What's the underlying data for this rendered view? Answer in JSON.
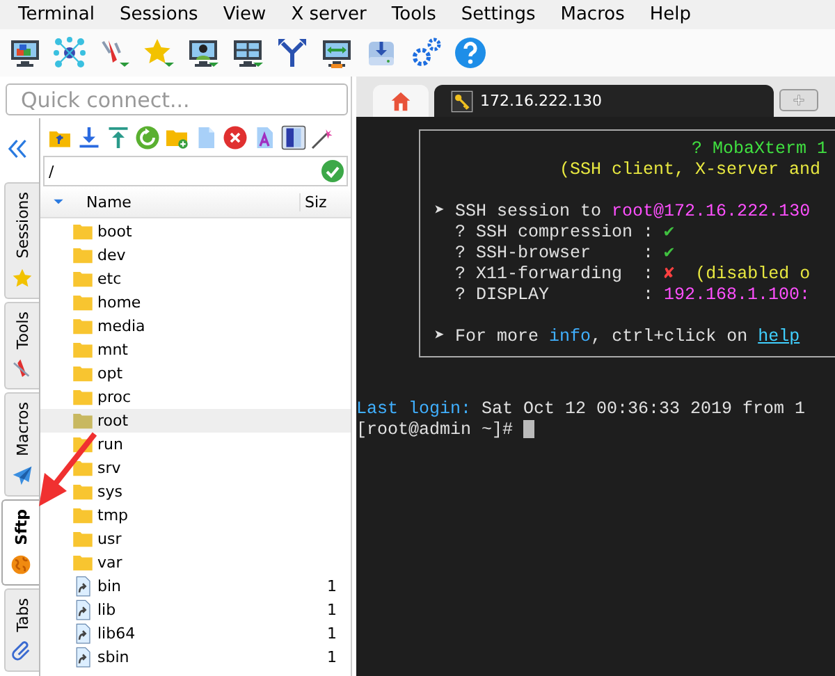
{
  "menu": [
    "Terminal",
    "Sessions",
    "View",
    "X server",
    "Tools",
    "Settings",
    "Macros",
    "Help"
  ],
  "quick_connect": {
    "placeholder": "Quick connect..."
  },
  "side_tabs": [
    {
      "label": "Sessions",
      "kind": "star",
      "selected": false
    },
    {
      "label": "Tools",
      "kind": "tools",
      "selected": false
    },
    {
      "label": "Macros",
      "kind": "plane",
      "selected": false
    },
    {
      "label": "Sftp",
      "kind": "globe",
      "selected": true
    },
    {
      "label": "Tabs",
      "kind": "clip",
      "selected": false
    }
  ],
  "sftp": {
    "path": "/",
    "columns": [
      "Name",
      "Siz"
    ],
    "rows": [
      {
        "kind": "folder",
        "name": "boot",
        "selected": false
      },
      {
        "kind": "folder",
        "name": "dev",
        "selected": false
      },
      {
        "kind": "folder",
        "name": "etc",
        "selected": false
      },
      {
        "kind": "folder",
        "name": "home",
        "selected": false
      },
      {
        "kind": "folder",
        "name": "media",
        "selected": false
      },
      {
        "kind": "folder",
        "name": "mnt",
        "selected": false
      },
      {
        "kind": "folder",
        "name": "opt",
        "selected": false
      },
      {
        "kind": "folder",
        "name": "proc",
        "selected": false
      },
      {
        "kind": "folder",
        "name": "root",
        "selected": true
      },
      {
        "kind": "folder",
        "name": "run",
        "selected": false
      },
      {
        "kind": "folder",
        "name": "srv",
        "selected": false
      },
      {
        "kind": "folder",
        "name": "sys",
        "selected": false
      },
      {
        "kind": "folder",
        "name": "tmp",
        "selected": false
      },
      {
        "kind": "folder",
        "name": "usr",
        "selected": false
      },
      {
        "kind": "folder",
        "name": "var",
        "selected": false
      },
      {
        "kind": "link",
        "name": "bin",
        "size": "1",
        "selected": false
      },
      {
        "kind": "link",
        "name": "lib",
        "size": "1",
        "selected": false
      },
      {
        "kind": "link",
        "name": "lib64",
        "size": "1",
        "selected": false
      },
      {
        "kind": "link",
        "name": "sbin",
        "size": "1",
        "selected": false
      }
    ]
  },
  "terminal_tabs": [
    {
      "kind": "home",
      "selected": false
    },
    {
      "kind": "session",
      "label": "172.16.222.130",
      "selected": true
    }
  ],
  "banner": [
    {
      "kind": "title",
      "segments": [
        {
          "text": "? MobaXterm 1",
          "color": "#40e040"
        }
      ]
    },
    {
      "kind": "subtitle",
      "segments": [
        {
          "text": "(SSH client, X-server and",
          "color": "#e8e840"
        }
      ]
    },
    {
      "kind": "blank"
    },
    {
      "kind": "item",
      "segments": [
        {
          "text": "➤ SSH session to ",
          "color": "#e0e0e0"
        },
        {
          "text": "root@172.16.222.130",
          "color": "#ff50ff"
        }
      ]
    },
    {
      "kind": "sub",
      "segments": [
        {
          "text": "? SSH compression : ",
          "color": "#e0e0e0"
        },
        {
          "text": "✔",
          "color": "#40c040"
        }
      ]
    },
    {
      "kind": "sub",
      "segments": [
        {
          "text": "? SSH-browser     : ",
          "color": "#e0e0e0"
        },
        {
          "text": "✔",
          "color": "#40c040"
        }
      ]
    },
    {
      "kind": "sub",
      "segments": [
        {
          "text": "? X11-forwarding  : ",
          "color": "#e0e0e0"
        },
        {
          "text": "✘",
          "color": "#ff4040"
        },
        {
          "text": "  (disabled o",
          "color": "#e8e840"
        }
      ]
    },
    {
      "kind": "sub",
      "segments": [
        {
          "text": "? DISPLAY         : ",
          "color": "#e0e0e0"
        },
        {
          "text": "192.168.1.100:",
          "color": "#ff50ff"
        }
      ]
    },
    {
      "kind": "blank"
    },
    {
      "kind": "item",
      "segments": [
        {
          "text": "➤ For more ",
          "color": "#e0e0e0"
        },
        {
          "text": "info",
          "color": "#40b0ff"
        },
        {
          "text": ", ctrl+click on ",
          "color": "#e0e0e0"
        },
        {
          "text": "help",
          "color": "#40d0ff",
          "kind": "link"
        }
      ]
    }
  ],
  "output": [
    {
      "segments": [
        {
          "text": "Last login:",
          "color": "#40b0ff"
        },
        {
          "text": " Sat Oct 12 00:36:33 2019 from 1",
          "color": "#e0e0e0"
        }
      ]
    },
    {
      "segments": [
        {
          "text": "[root@admin ~]# ",
          "color": "#e0e0e0"
        }
      ],
      "cursor": true
    }
  ],
  "annotation": {
    "kind": "arrow",
    "color": "#f03030"
  }
}
